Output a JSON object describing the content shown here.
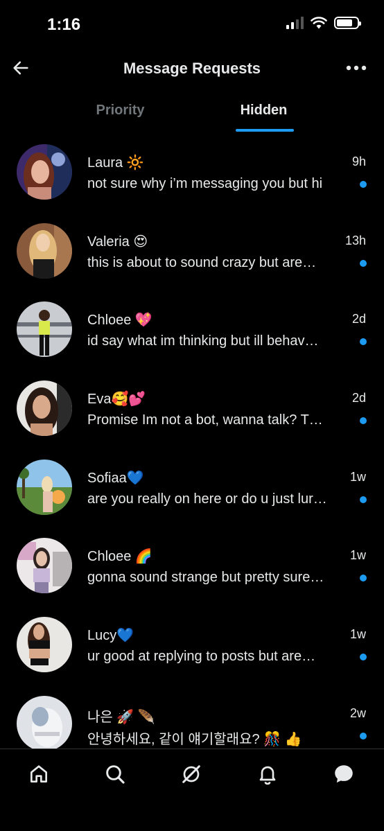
{
  "status_bar": {
    "time": "1:16"
  },
  "header": {
    "title": "Message Requests"
  },
  "tabs": [
    {
      "label": "Priority",
      "active": false
    },
    {
      "label": "Hidden",
      "active": true
    }
  ],
  "accent_color": "#1d9bf0",
  "conversations": [
    {
      "name": "Laura 🔆",
      "time": "9h",
      "preview": "not sure why i’m messaging you but hi",
      "unread": true
    },
    {
      "name": "Valeria 😍",
      "time": "13h",
      "preview": "this is about to sound crazy but are…",
      "unread": true
    },
    {
      "name": "Chloee 💖",
      "time": "2d",
      "preview": "id say what im thinking but ill behav…",
      "unread": true
    },
    {
      "name": "Eva🥰💕",
      "time": "2d",
      "preview": "Promise Im not a bot, wanna talk? T…",
      "unread": true
    },
    {
      "name": "Sofiaa💙",
      "time": "1w",
      "preview": "are you really on here or do u just lur…",
      "unread": true
    },
    {
      "name": "Chloee 🌈",
      "time": "1w",
      "preview": "gonna sound strange but pretty sure…",
      "unread": true
    },
    {
      "name": "Lucy💙",
      "time": "1w",
      "preview": "ur good at replying to posts but are…",
      "unread": true
    },
    {
      "name": "나은 🚀 🪶",
      "time": "2w",
      "preview": "안녕하세요, 같이 얘기할래요? 🎊 👍",
      "unread": true
    }
  ],
  "bottom_nav": [
    {
      "icon": "home-icon"
    },
    {
      "icon": "search-icon"
    },
    {
      "icon": "grok-icon"
    },
    {
      "icon": "bell-icon"
    },
    {
      "icon": "messages-icon",
      "active": true
    }
  ]
}
